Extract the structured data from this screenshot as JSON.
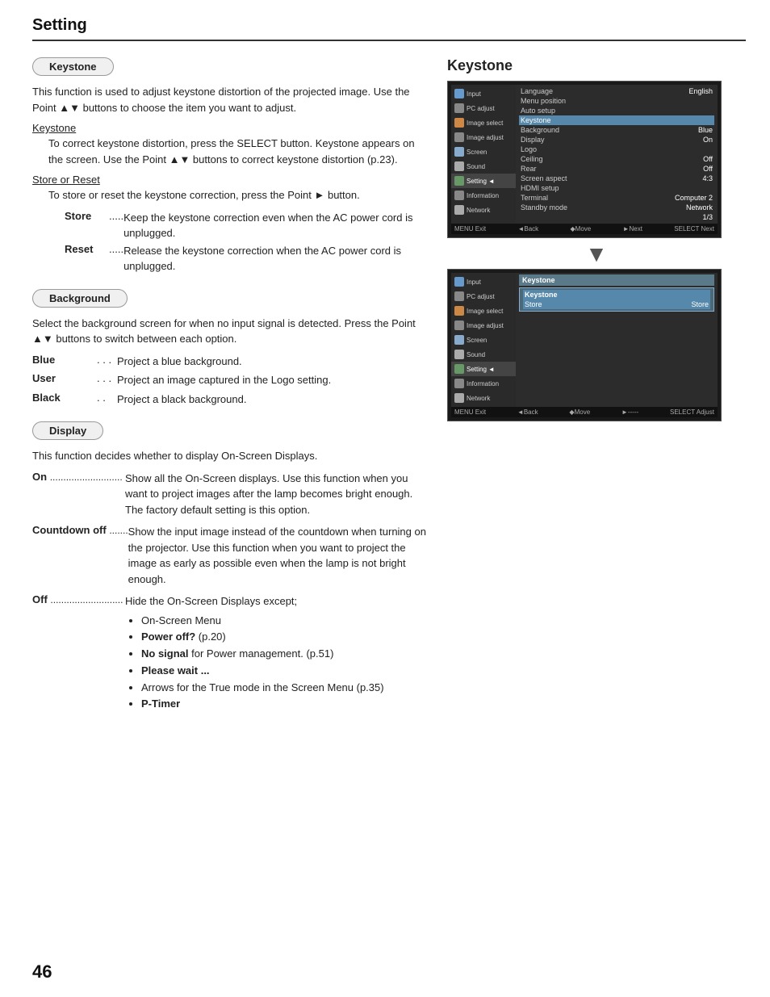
{
  "header": {
    "title": "Setting"
  },
  "keystone_section": {
    "label": "Keystone",
    "title": "Keystone",
    "intro": "This function is used to adjust keystone distortion of the projected image. Use the Point ▲▼ buttons to choose the item you want to adjust.",
    "subheading1": "Keystone",
    "para1": "To correct keystone distortion, press the SELECT button. Keystone appears on the screen. Use the Point ▲▼ buttons to correct keystone distortion (p.23).",
    "subheading2": "Store or Reset",
    "para2": "To store or reset the keystone correction, press the Point ► button.",
    "store_label": "Store",
    "store_dots": ".....",
    "store_desc": "Keep the keystone correction even when the AC power cord is unplugged.",
    "reset_label": "Reset",
    "reset_dots": ".....",
    "reset_desc": "Release the keystone correction when the AC power cord is unplugged."
  },
  "background_section": {
    "label": "Background",
    "intro": "Select the background screen for when no input signal is detected. Press the Point ▲▼ buttons to switch between each option.",
    "blue_label": "Blue",
    "blue_dots": ". . .",
    "blue_desc": "Project a blue background.",
    "user_label": "User",
    "user_dots": ". . .",
    "user_desc": "Project an image captured in the Logo setting.",
    "black_label": "Black",
    "black_dots": ". .",
    "black_desc": "Project a black background."
  },
  "display_section": {
    "label": "Display",
    "intro": "This function decides whether to display On-Screen Displays.",
    "on_label": "On",
    "on_dots": "...........................",
    "on_desc": "Show all the On-Screen displays. Use this function when you want to project images after the lamp becomes bright enough. The factory default setting is this option.",
    "countdown_label": "Countdown off",
    "countdown_dots": ".......",
    "countdown_desc": "Show the input image instead of the countdown when turning on the projector. Use this function when you want to project the image as early as possible even when the lamp is not bright enough.",
    "off_label": "Off",
    "off_dots": "...........................",
    "off_desc": "Hide the On-Screen Displays except;",
    "off_bullets": [
      "On-Screen Menu",
      "Power off? (p.20)",
      "No signal for Power management. (p.51)",
      "Please wait ...",
      "Arrows for the True mode in the Screen Menu (p.35)",
      "P-Timer"
    ]
  },
  "osd1": {
    "sidebar_items": [
      "Input",
      "PC adjust",
      "Image select",
      "Image adjust",
      "Screen",
      "Sound",
      "Setting",
      "Information",
      "Network"
    ],
    "active_item": "Setting",
    "menu_rows": [
      {
        "label": "Language",
        "value": "English"
      },
      {
        "label": "Menu position",
        "value": ""
      },
      {
        "label": "Auto setup",
        "value": ""
      },
      {
        "label": "Keystone",
        "value": "",
        "highlighted": true
      },
      {
        "label": "Background",
        "value": "Blue"
      },
      {
        "label": "Display",
        "value": "On"
      },
      {
        "label": "Logo",
        "value": ""
      },
      {
        "label": "Ceiling",
        "value": "Off"
      },
      {
        "label": "Rear",
        "value": "Off"
      },
      {
        "label": "Screen aspect",
        "value": "4:3"
      },
      {
        "label": "HDMI setup",
        "value": ""
      },
      {
        "label": "Terminal",
        "value": "Computer 2"
      },
      {
        "label": "Standby mode",
        "value": "Network"
      }
    ],
    "page_indicator": "1/3",
    "footer": [
      "MENU Exit",
      "◄Back",
      "◆Move",
      "►Next",
      "SELECT Next"
    ]
  },
  "osd2": {
    "sidebar_items": [
      "Input",
      "PC adjust",
      "Image select",
      "Image adjust",
      "Screen",
      "Sound",
      "Setting",
      "Information",
      "Network"
    ],
    "active_item": "Setting",
    "keystone_panel": {
      "title": "Keystone",
      "sub_title": "Keystone",
      "store_label": "Store",
      "store_value": "Store"
    },
    "footer": [
      "MENU Exit",
      "◄Back",
      "◆Move",
      "►-----",
      "SELECT Adjust"
    ]
  },
  "page_number": "46"
}
